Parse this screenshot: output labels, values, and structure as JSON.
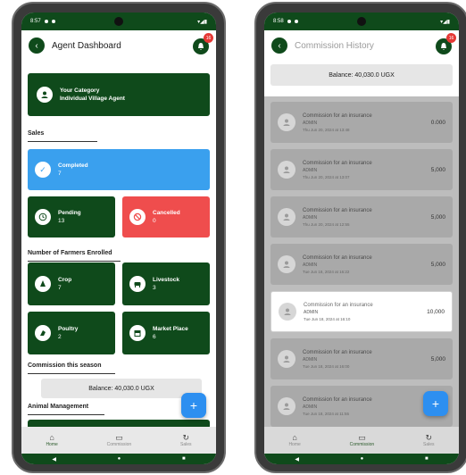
{
  "left_screen": {
    "status_time": "8:57",
    "title": "Agent Dashboard",
    "notification_count": "16",
    "category": {
      "label": "Your Category",
      "value": "Individual Village Agent"
    },
    "sales_label": "Sales",
    "completed": {
      "label": "Completed",
      "value": "7"
    },
    "pending": {
      "label": "Pending",
      "value": "13"
    },
    "cancelled": {
      "label": "Cancelled",
      "value": "0"
    },
    "farmers_label": "Number of Farmers Enrolled",
    "crop": {
      "label": "Crop",
      "value": "7"
    },
    "livestock": {
      "label": "Livestock",
      "value": "3"
    },
    "poultry": {
      "label": "Poultry",
      "value": "2"
    },
    "market": {
      "label": "Market Place",
      "value": "6"
    },
    "commission_label": "Commission this season",
    "balance": "Balance: 40,030.0 UGX",
    "animal_label": "Animal Management",
    "nav": {
      "home": "Home",
      "commission": "Commission",
      "sales": "Sales"
    }
  },
  "right_screen": {
    "status_time": "8:58",
    "title": "Commission History",
    "notification_count": "16",
    "balance": "Balance: 40,030.0 UGX",
    "items": [
      {
        "title": "Commission for an insurance",
        "by": "ADMIN",
        "date": "Thu Jun 20, 2024 at 13:48",
        "amount": "0.000"
      },
      {
        "title": "Commission for an insurance",
        "by": "ADMIN",
        "date": "Thu Jun 20, 2024 at 13:07",
        "amount": "5,000"
      },
      {
        "title": "Commission for an insurance",
        "by": "ADMIN",
        "date": "Thu Jun 20, 2024 at 12:55",
        "amount": "5,000"
      },
      {
        "title": "Commission for an insurance",
        "by": "ADMIN",
        "date": "Tue Jun 18, 2024 at 16:22",
        "amount": "5,000"
      },
      {
        "title": "Commission for an insurance",
        "by": "ADMIN",
        "date": "Tue Jun 18, 2024 at 16:10",
        "amount": "10,000"
      },
      {
        "title": "Commission for an insurance",
        "by": "ADMIN",
        "date": "Tue Jun 18, 2024 at 16:00",
        "amount": "5,000"
      },
      {
        "title": "Commission for an insurance",
        "by": "ADMIN",
        "date": "Tue Jun 18, 2024 at 11:55",
        "amount": "5,000"
      }
    ],
    "nav": {
      "home": "Home",
      "commission": "Commission",
      "sales": "Sales"
    }
  }
}
